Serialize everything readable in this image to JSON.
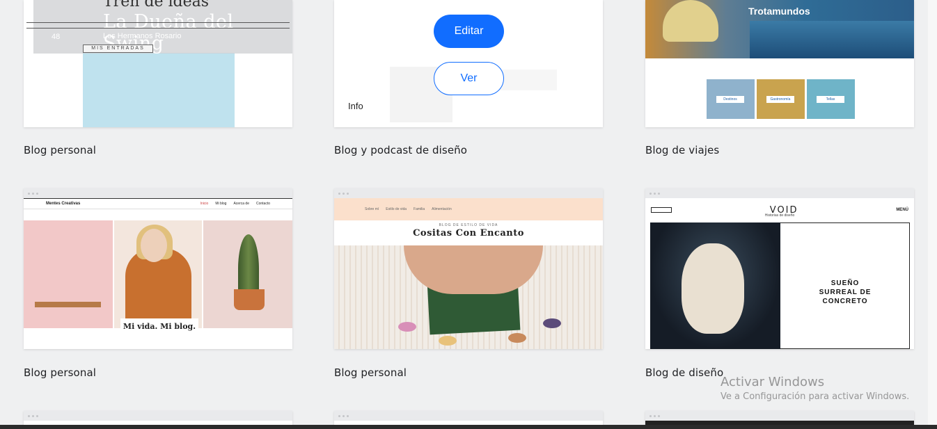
{
  "cards": [
    {
      "label": "Blog personal",
      "overlay_title": "La Dueña del Swing",
      "overlay_title_top": "Tren de ideas",
      "overlay_sub": "Los Hermanos Rosario",
      "overlay_num": "48",
      "entries_label": "MIS ENTRADAS"
    },
    {
      "label": "Blog y podcast de diseño",
      "edit_button": "Editar",
      "view_button": "Ver",
      "info_link": "Info"
    },
    {
      "label": "Blog de viajes",
      "brand": "Trotamundos",
      "thumbs": [
        "Destinos",
        "Gastronomía",
        "Tellas"
      ]
    },
    {
      "label": "Blog personal",
      "site_name": "Mentes Creativas",
      "nav_links": [
        "Inicio",
        "Mi blog",
        "Acerca de",
        "Contacto"
      ],
      "banner_text": "Mi vida. Mi blog."
    },
    {
      "label": "Blog personal",
      "nav_links": [
        "Sobre mí",
        "Estilo de vida",
        "Familia",
        "Alimentación"
      ],
      "eyebrow": "BLOG DE ESTILO DE VIDA",
      "title": "Cositas Con Encanto"
    },
    {
      "label": "Blog de diseño",
      "logo": "VOID",
      "menu": "MENÚ",
      "subtitle": "Historias de diseño",
      "headline_1": "SUEÑO",
      "headline_2": "SURREAL DE",
      "headline_3": "CONCRETO"
    }
  ],
  "watermark": {
    "title": "Activar Windows",
    "subtitle": "Ve a Configuración para activar Windows."
  },
  "colors": {
    "accent": "#116dff",
    "background": "#eff0f1"
  }
}
